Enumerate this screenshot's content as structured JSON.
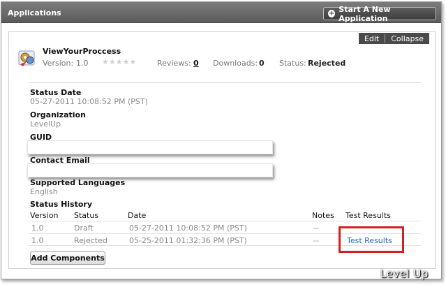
{
  "header": {
    "title": "Applications",
    "start_button": "Start A New Application"
  },
  "toolbar": {
    "edit": "Edit",
    "collapse": "Collapse"
  },
  "app": {
    "name": "ViewYourProccess",
    "version_label": "Version:",
    "version": "1.0",
    "rating_stars": 5,
    "reviews_label": "Reviews:",
    "reviews_count": "0",
    "downloads_label": "Downloads:",
    "downloads_count": "0",
    "status_label": "Status:",
    "status": "Rejected"
  },
  "details": {
    "status_date_label": "Status Date",
    "status_date": "05-27-2011 10:08:52 PM (PST)",
    "organization_label": "Organization",
    "organization": "LevelUp",
    "guid_label": "GUID",
    "contact_email_label": "Contact Email",
    "languages_label": "Supported Languages",
    "languages": "English"
  },
  "history": {
    "title": "Status History",
    "columns": [
      "Version",
      "Status",
      "Date",
      "Notes",
      "Test Results"
    ],
    "rows": [
      {
        "version": "1.0",
        "status": "Draft",
        "date": "05-27-2011 10:08:52 PM (PST)",
        "notes": "--",
        "test_results": ""
      },
      {
        "version": "1.0",
        "status": "Rejected",
        "date": "05-25-2011 01:32:36 PM (PST)",
        "notes": "--",
        "test_results": "Test Results"
      }
    ]
  },
  "actions": {
    "add_components": "Add Components"
  },
  "watermark": "Level Up",
  "colors": {
    "accent_link": "#2a6bb5",
    "highlight": "#d51f1f",
    "header_bg": "#6a6a6a"
  }
}
